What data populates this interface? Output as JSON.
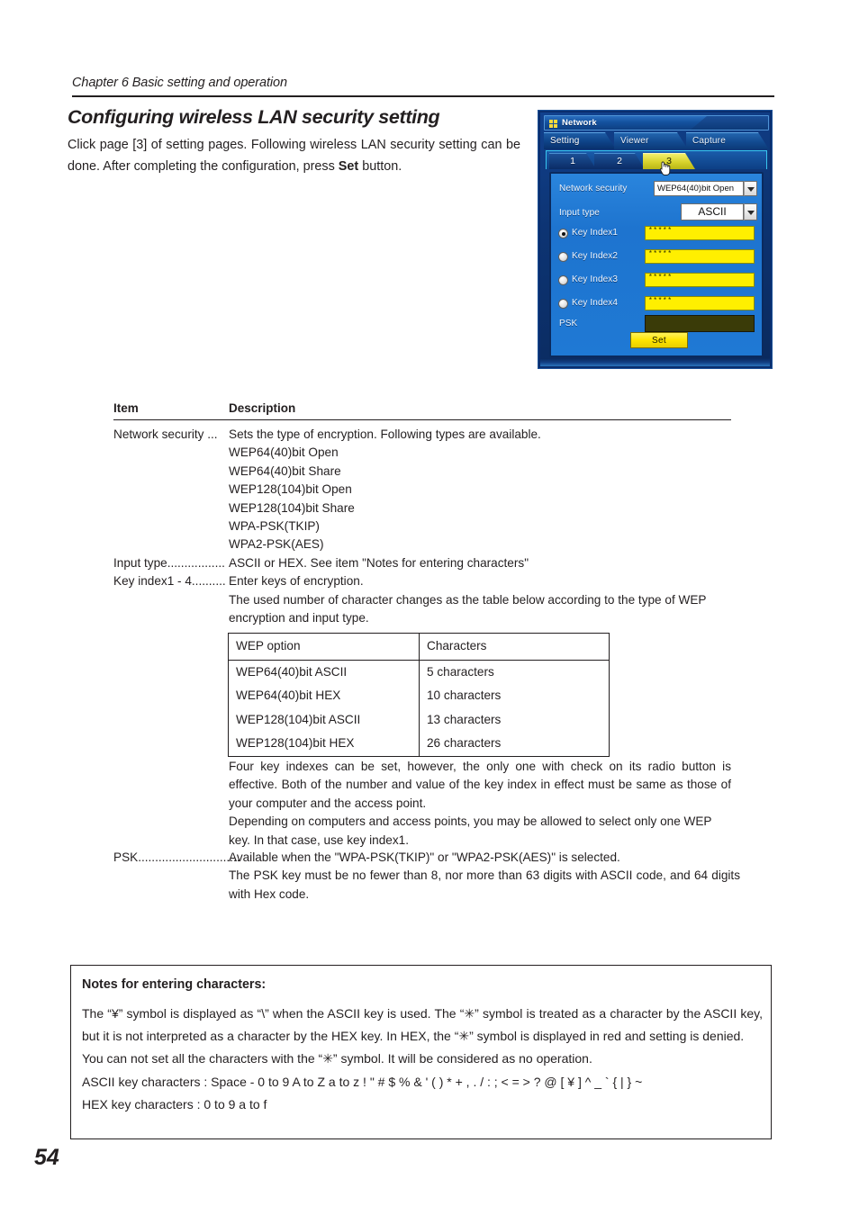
{
  "page": {
    "running_head": "Chapter 6 Basic setting and operation",
    "page_number": "54"
  },
  "heading": {
    "title": "Configuring wireless LAN security setting",
    "intro_part1": "Click page [3] of setting pages.  Following wireless LAN security setting can be done. After completing the configuration, press ",
    "intro_bold": "Set",
    "intro_part2": " button."
  },
  "screenshot": {
    "window_title": "Network",
    "icon": "network-squares-icon",
    "main_tabs": [
      {
        "label": "Setting",
        "active": true
      },
      {
        "label": "Viewer",
        "active": false
      },
      {
        "label": "Capture",
        "active": false
      }
    ],
    "page_tabs": [
      {
        "label": "1",
        "selected": false
      },
      {
        "label": "2",
        "selected": false
      },
      {
        "label": "3",
        "selected": true
      }
    ],
    "fields": {
      "network_security_label": "Network security",
      "network_security_value": "WEP64(40)bit Open",
      "input_type_label": "Input type",
      "input_type_value": "ASCII",
      "key_indexes": [
        {
          "label": "Key Index1",
          "value": "*****",
          "checked": true
        },
        {
          "label": "Key Index2",
          "value": "*****",
          "checked": false
        },
        {
          "label": "Key Index3",
          "value": "*****",
          "checked": false
        },
        {
          "label": "Key Index4",
          "value": "*****",
          "checked": false
        }
      ],
      "psk_label": "PSK",
      "psk_value": "",
      "set_button": "Set"
    },
    "colors": {
      "panel_blue": "#1f79d4",
      "field_yellow": "#ffef00",
      "selected_tab_yellow": "#d6d22b",
      "title_bar_blue": "#14529f"
    }
  },
  "definition_table": {
    "header": {
      "item": "Item",
      "description": "Description"
    },
    "rows": [
      {
        "term": "Network security ...",
        "desc": "Sets the type of encryption. Following types are available.",
        "continuation": [
          "WEP64(40)bit Open",
          "WEP64(40)bit Share",
          "WEP128(104)bit Open",
          "WEP128(104)bit Share",
          "WPA-PSK(TKIP)",
          "WPA2-PSK(AES)"
        ]
      },
      {
        "term": "Input type.................",
        "desc": "ASCII or HEX. See item \"Notes for entering characters\"",
        "continuation": []
      },
      {
        "term": "Key index1 - 4..........",
        "desc": "Enter keys of encryption.",
        "continuation": [
          "The used number of character changes as the table below according to the type of WEP encryption and input type."
        ]
      }
    ]
  },
  "wep_table": {
    "headers": [
      "WEP option",
      "Characters"
    ],
    "rows": [
      [
        "WEP64(40)bit ASCII",
        "5 characters"
      ],
      [
        "WEP64(40)bit HEX",
        "10 characters"
      ],
      [
        "WEP128(104)bit ASCII",
        "13 characters"
      ],
      [
        "WEP128(104)bit HEX",
        "26 characters"
      ]
    ]
  },
  "after_table_text": {
    "paragraph1": "Four key indexes can be set, however, the only one with check on its radio button is effective. Both of the number and value of the key index in effect must be same as those of your computer and the access point.",
    "paragraph2": "Depending on computers and access points, you may be allowed to select only one WEP key. In that case, use key index1."
  },
  "psk_entry": {
    "term": "PSK..............................",
    "desc": "Available when the \"WPA-PSK(TKIP)\" or \"WPA2-PSK(AES)\" is selected.",
    "continuation": "The PSK key must be no fewer than 8, nor more than 63 digits with ASCII code, and 64 digits with Hex code."
  },
  "notes": {
    "title": "Notes for entering characters:",
    "line1": "The “¥” symbol is displayed as “\\” when the ASCII key is used. The “✳” symbol is treated as a character by the ASCII key, but it is not interpreted as a character by the HEX key. In HEX, the “✳” symbol is displayed in red and setting is denied.",
    "line2": "You can not set all the characters with the “✳” symbol. It will be considered as no operation.",
    "line3": "ASCII key characters : Space - 0 to 9 A to Z a to z ! \" # $ % & ' ( ) * + , . / : ; < = > ? @ [ ¥ ] ^ _ ` { | } ~",
    "line4": "HEX key characters : 0 to 9 a to f"
  }
}
